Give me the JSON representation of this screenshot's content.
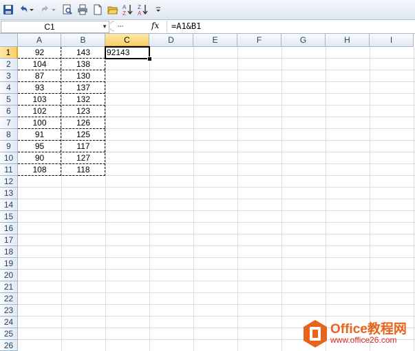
{
  "toolbar": {
    "items": [
      {
        "name": "save-icon"
      },
      {
        "name": "undo-icon"
      },
      {
        "name": "undo-dropdown-icon"
      },
      {
        "name": "redo-icon"
      },
      {
        "name": "redo-dropdown-icon"
      },
      {
        "name": "print-preview-icon"
      },
      {
        "name": "quick-print-icon"
      },
      {
        "name": "new-document-icon"
      },
      {
        "name": "open-folder-icon"
      },
      {
        "name": "sort-ascending-icon"
      },
      {
        "name": "sort-descending-icon"
      },
      {
        "name": "customize-toolbar-icon"
      }
    ],
    "sort_asc_top": "A",
    "sort_asc_bottom": "Z",
    "sort_desc_top": "Z",
    "sort_desc_bottom": "A"
  },
  "formula_bar": {
    "name_box": "C1",
    "fx_label": "fx",
    "formula": "=A1&B1"
  },
  "sheet": {
    "columns": [
      "A",
      "B",
      "C",
      "D",
      "E",
      "F",
      "G",
      "H",
      "I"
    ],
    "selected_column": "C",
    "selected_row": 1,
    "rows": [
      1,
      2,
      3,
      4,
      5,
      6,
      7,
      8,
      9,
      10,
      11,
      12,
      13,
      14,
      15,
      16,
      17,
      18,
      19,
      20,
      21,
      22,
      23,
      24,
      25,
      26
    ],
    "col_a": [
      "92",
      "104",
      "87",
      "93",
      "103",
      "102",
      "100",
      "91",
      "95",
      "90",
      "108"
    ],
    "col_b": [
      "143",
      "138",
      "130",
      "137",
      "132",
      "123",
      "126",
      "125",
      "117",
      "127",
      "118"
    ],
    "c1": "92143"
  },
  "watermark": {
    "brand": "Office教程网",
    "url": "www.office26.com",
    "colors": {
      "orange": "#e8641b",
      "red": "#d9261c"
    }
  }
}
